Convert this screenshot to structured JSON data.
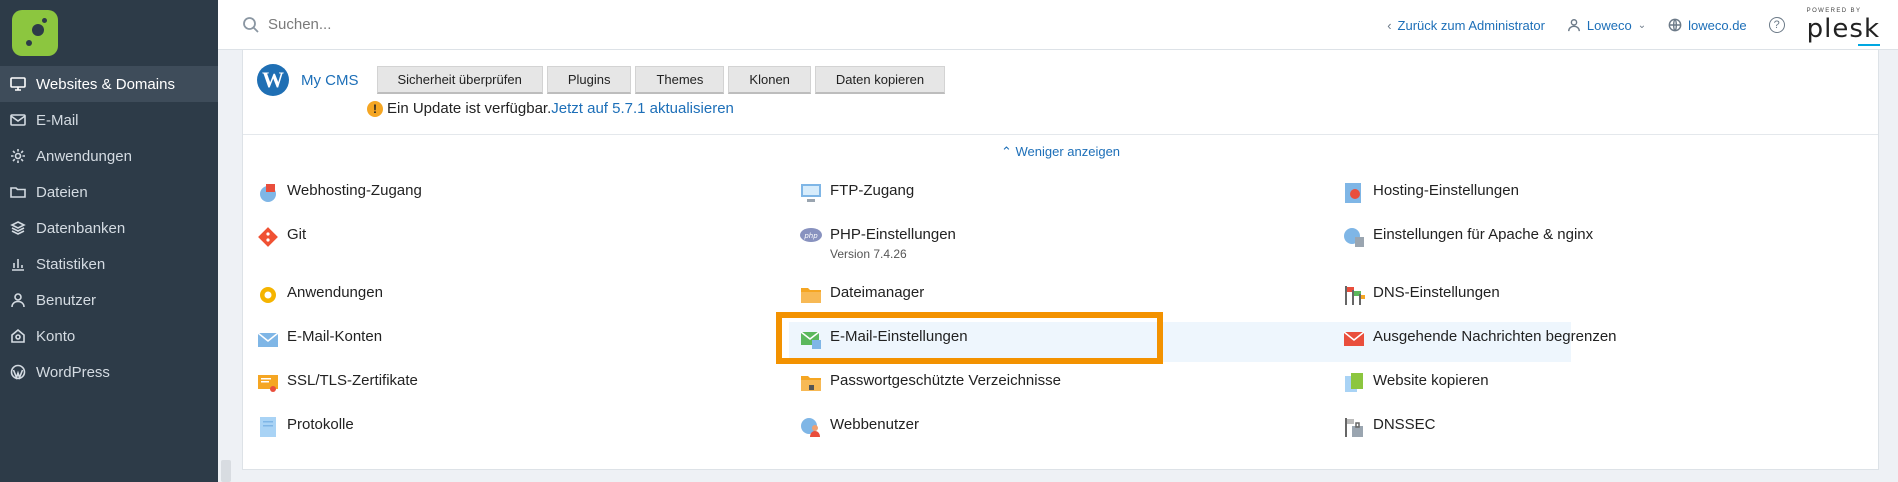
{
  "sidebar": {
    "items": [
      {
        "label": "Websites & Domains",
        "icon": "monitor-icon",
        "active": true
      },
      {
        "label": "E-Mail",
        "icon": "envelope-icon"
      },
      {
        "label": "Anwendungen",
        "icon": "gear-icon"
      },
      {
        "label": "Dateien",
        "icon": "folder-icon"
      },
      {
        "label": "Datenbanken",
        "icon": "database-icon"
      },
      {
        "label": "Statistiken",
        "icon": "bar-chart-icon"
      },
      {
        "label": "Benutzer",
        "icon": "user-icon"
      },
      {
        "label": "Konto",
        "icon": "account-icon"
      },
      {
        "label": "WordPress",
        "icon": "wordpress-icon"
      }
    ]
  },
  "header": {
    "search_placeholder": "Suchen...",
    "back_link": "Zurück zum Administrator",
    "user": "Loweco",
    "domain": "loweco.de",
    "help": "?",
    "powered_by": "POWERED BY",
    "brand": "plesk"
  },
  "cms": {
    "logo_letter": "W",
    "name": "My CMS",
    "buttons": [
      "Sicherheit überprüfen",
      "Plugins",
      "Themes",
      "Klonen",
      "Daten kopieren"
    ],
    "update_text": "Ein Update ist verfügbar.",
    "update_link": "Jetzt auf 5.7.1 aktualisieren",
    "warn_glyph": "!"
  },
  "less_link": "Weniger anzeigen",
  "tools": {
    "col1": [
      "Webhosting-Zugang",
      "Git",
      "Anwendungen",
      "E-Mail-Konten",
      "SSL/TLS-Zertifikate",
      "Protokolle"
    ],
    "col2": [
      "FTP-Zugang",
      "PHP-Einstellungen",
      "Dateimanager",
      "E-Mail-Einstellungen",
      "Passwortgeschützte Verzeichnisse",
      "Webbenutzer"
    ],
    "php_version": "Version 7.4.26",
    "col3": [
      "Hosting-Einstellungen",
      "Einstellungen für Apache & nginx",
      "DNS-Einstellungen",
      "Ausgehende Nachrichten begrenzen",
      "Website kopieren",
      "DNSSEC"
    ]
  },
  "colors": {
    "sidebar_bg": "#2d3b48",
    "accent_link": "#1d6fb8",
    "highlight": "#f39200",
    "logo_green": "#8cc63f"
  }
}
